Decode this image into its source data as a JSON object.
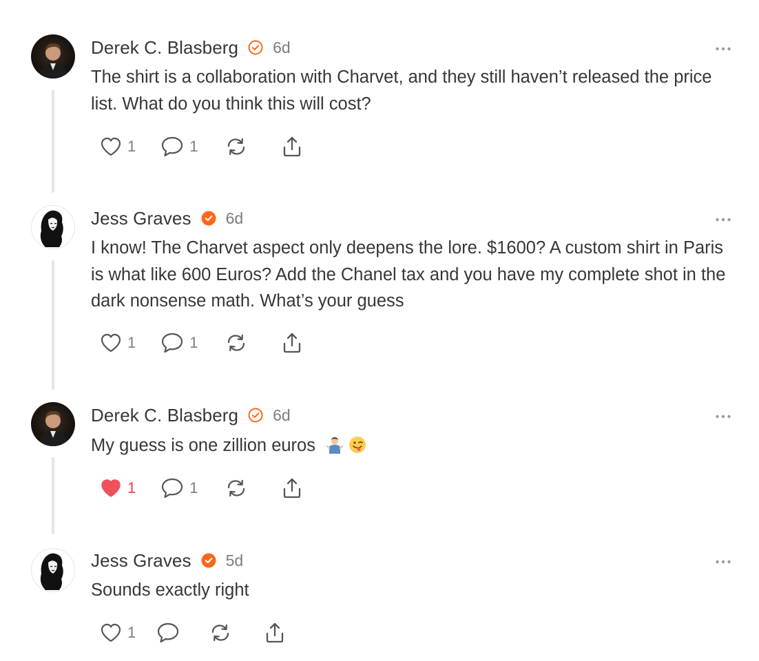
{
  "comments": [
    {
      "author": "Derek C. Blasberg",
      "time": "6d",
      "text": "The shirt is a collaboration with Charvet, and they still haven’t released the price list. What do you think this will cost?",
      "likes": "1",
      "replies": "1",
      "liked": false,
      "badge": "outline"
    },
    {
      "author": "Jess Graves",
      "time": "6d",
      "text": "I know! The Charvet aspect only deepens the lore. $1600? A custom shirt in Paris is what like 600 Euros? Add the Chanel tax and you have my complete shot in the dark nonsense math. What’s your guess",
      "likes": "1",
      "replies": "1",
      "liked": false,
      "badge": "filled"
    },
    {
      "author": "Derek C. Blasberg",
      "time": "6d",
      "text": "My guess is one zillion euros",
      "emojis": [
        "person-shrugging-emoji",
        "winking-face-with-tongue-emoji"
      ],
      "likes": "1",
      "replies": "1",
      "liked": true,
      "badge": "outline"
    },
    {
      "author": "Jess Graves",
      "time": "5d",
      "text": "Sounds exactly right",
      "likes": "1",
      "replies": "",
      "liked": false,
      "badge": "filled"
    }
  ],
  "icons": {
    "like": "heart-icon",
    "reply": "speech-bubble-icon",
    "restack": "restack-icon",
    "share": "share-icon",
    "more": "ellipsis-icon"
  },
  "colors": {
    "accent": "#ff6719",
    "liked": "#e0404d",
    "text": "#363737",
    "muted": "#7c7c7c",
    "thread_line": "#e5e5e5"
  }
}
